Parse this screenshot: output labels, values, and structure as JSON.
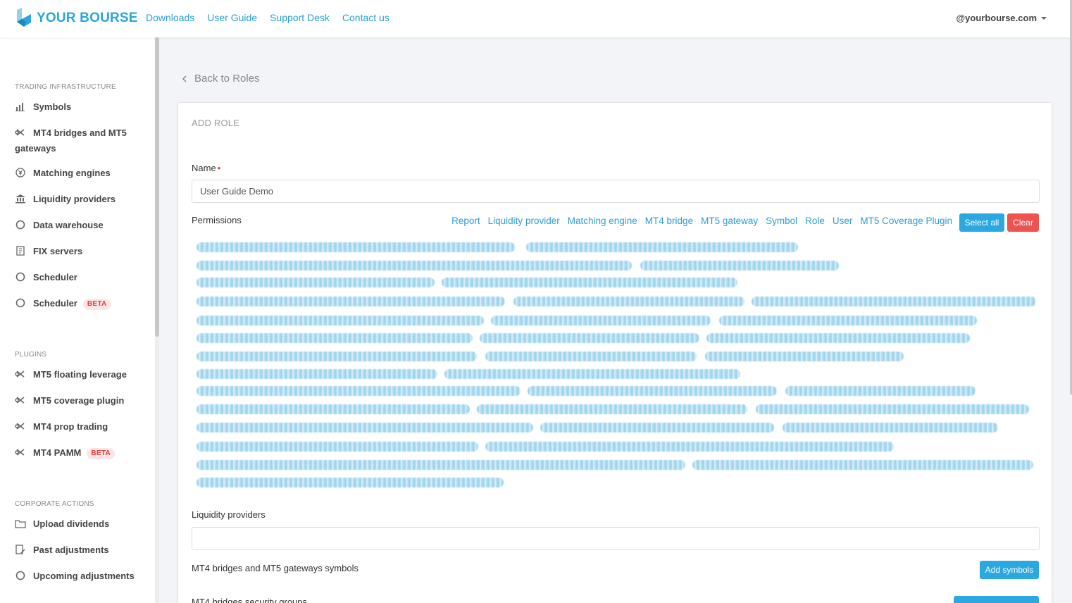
{
  "brand": {
    "name": "YOUR BOURSE",
    "primary_color": "#2aa6dc",
    "danger_color": "#ef5350"
  },
  "topnav": [
    "Downloads",
    "User Guide",
    "Support Desk",
    "Contact us"
  ],
  "account": {
    "email": "@yourbourse.com"
  },
  "sidebar": {
    "sections": [
      {
        "title": "TRADING INFRASTRUCTURE",
        "items": [
          {
            "label": "Symbols",
            "icon": "bar-chart-icon"
          },
          {
            "label": "MT4 bridges and MT5 gateways",
            "icon": "bridge-icon"
          },
          {
            "label": "Matching engines",
            "icon": "yen-coin-icon"
          },
          {
            "label": "Liquidity providers",
            "icon": "bank-icon"
          },
          {
            "label": "Data warehouse",
            "icon": "circle-icon"
          },
          {
            "label": "FIX servers",
            "icon": "document-icon"
          },
          {
            "label": "Scheduler",
            "icon": "circle-icon"
          },
          {
            "label": "Scheduler",
            "icon": "circle-icon",
            "badge": "BETA"
          }
        ]
      },
      {
        "title": "PLUGINS",
        "items": [
          {
            "label": "MT5 floating leverage",
            "icon": "bridge-icon"
          },
          {
            "label": "MT5 coverage plugin",
            "icon": "bridge-icon"
          },
          {
            "label": "MT4 prop trading",
            "icon": "bridge-icon"
          },
          {
            "label": "MT4 PAMM",
            "icon": "bridge-icon",
            "badge": "BETA"
          }
        ]
      },
      {
        "title": "CORPORATE ACTIONS",
        "items": [
          {
            "label": "Upload dividends",
            "icon": "folder-icon"
          },
          {
            "label": "Past adjustments",
            "icon": "edit-document-icon"
          },
          {
            "label": "Upcoming adjustments",
            "icon": "circle-icon"
          }
        ]
      }
    ]
  },
  "main": {
    "back_label": "Back to Roles",
    "card_title": "ADD ROLE",
    "name_label": "Name",
    "name_value": "User Guide Demo",
    "permissions_label": "Permissions",
    "permission_filters": [
      "Report",
      "Liquidity provider",
      "Matching engine",
      "MT4 bridge",
      "MT5 gateway",
      "Symbol",
      "Role",
      "User",
      "MT5 Coverage Plugin"
    ],
    "select_all_label": "Select all",
    "clear_label": "Clear",
    "liquidity_providers_label": "Liquidity providers",
    "liquidity_providers_value": "",
    "bridges_symbols_label": "MT4 bridges and MT5 gateways symbols",
    "add_symbols_label": "Add symbols",
    "security_groups_label": "MT4 bridges security groups"
  }
}
